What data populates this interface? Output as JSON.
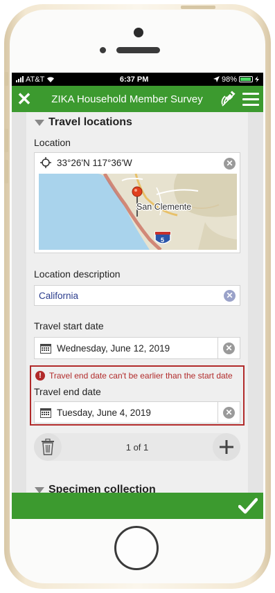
{
  "status_bar": {
    "carrier": "AT&T",
    "time": "6:37 PM",
    "battery": "98%"
  },
  "app_bar": {
    "title": "ZIKA Household Member Survey"
  },
  "travel_group": {
    "title": "Travel locations",
    "location": {
      "label": "Location",
      "coordinates": "33°26'N 117°36'W",
      "map_place": "San Clemente",
      "map_route": "5"
    },
    "location_description": {
      "label": "Location description",
      "value": "California"
    },
    "travel_start": {
      "label": "Travel start date",
      "value": "Wednesday, June 12, 2019"
    },
    "travel_end": {
      "label": "Travel end date",
      "value": "Tuesday, June 4, 2019",
      "error": "Travel end date can't be earlier than the start date"
    },
    "pager": {
      "count": "1 of 1"
    }
  },
  "specimen_group": {
    "title": "Specimen collection"
  },
  "colors": {
    "brand_green": "#3c9a2f",
    "error_red": "#b12a2a",
    "link_blue": "#2a3c8c"
  }
}
